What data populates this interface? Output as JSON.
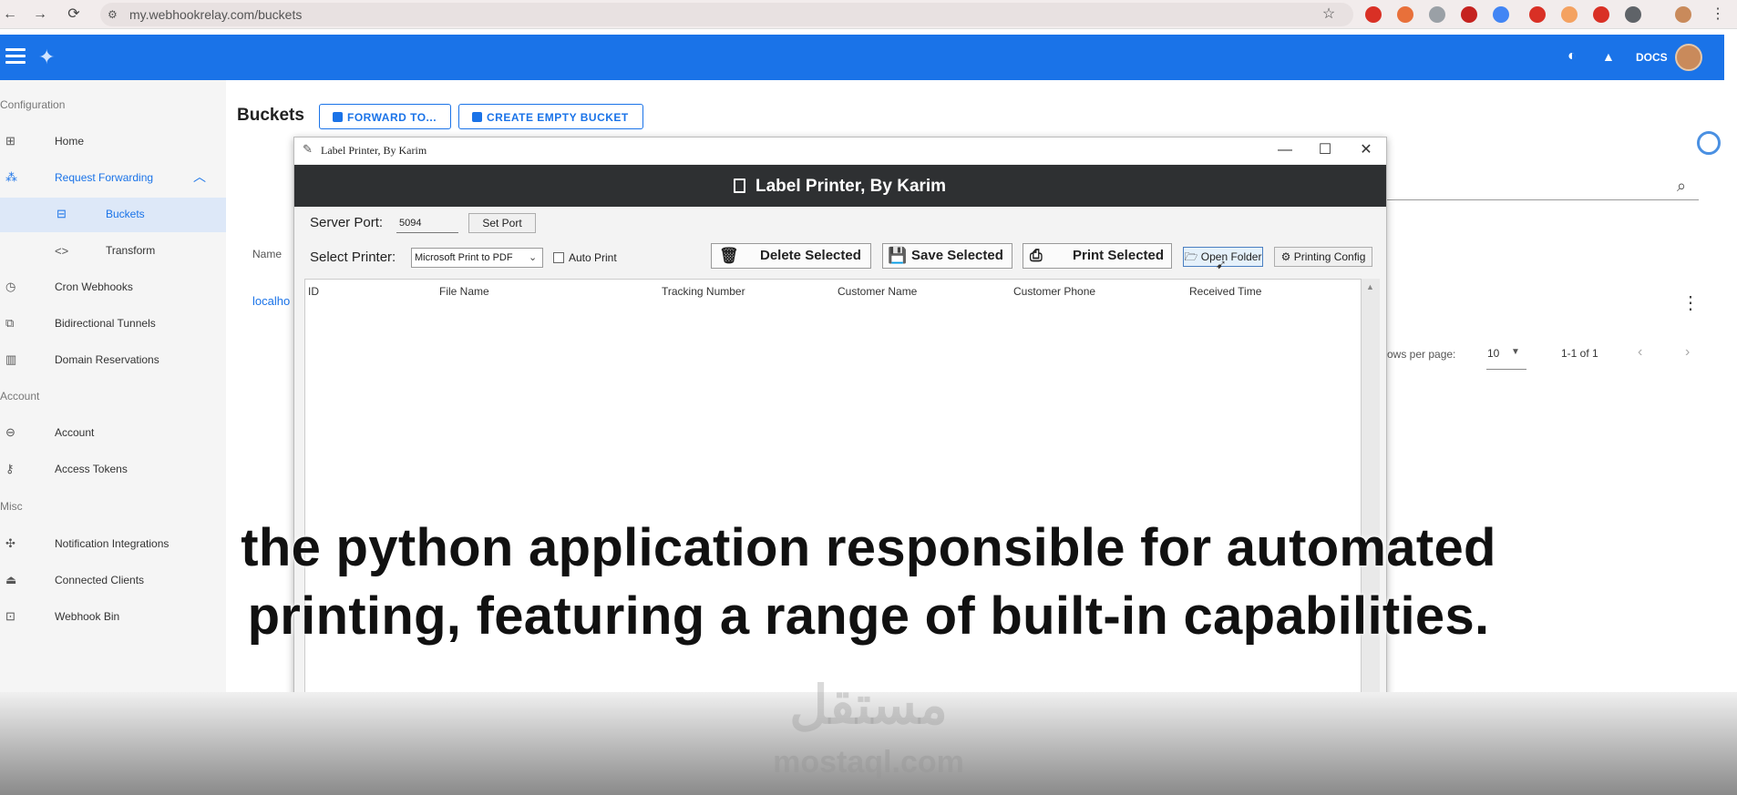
{
  "browser": {
    "url": "my.webhookrelay.com/buckets",
    "back": "←",
    "forward": "→",
    "reload": "⟳",
    "star": "☆",
    "more": "⋮"
  },
  "appbar": {
    "docs_label": "DOCS"
  },
  "sidebar": {
    "sections": {
      "configuration": "Configuration",
      "account": "Account",
      "misc": "Misc"
    },
    "items": [
      {
        "label": "Home",
        "icon": "⊞"
      },
      {
        "label": "Request Forwarding",
        "icon": "⁂"
      },
      {
        "label": "Buckets",
        "icon": "⊟"
      },
      {
        "label": "Transform",
        "icon": "<>"
      },
      {
        "label": "Cron Webhooks",
        "icon": "◷"
      },
      {
        "label": "Bidirectional Tunnels",
        "icon": "⧉"
      },
      {
        "label": "Domain Reservations",
        "icon": "▥"
      },
      {
        "label": "Account",
        "icon": "⊖"
      },
      {
        "label": "Access Tokens",
        "icon": "⚷"
      },
      {
        "label": "Notification Integrations",
        "icon": "✣"
      },
      {
        "label": "Connected Clients",
        "icon": "⏏"
      },
      {
        "label": "Webhook Bin",
        "icon": "⊡"
      }
    ]
  },
  "main": {
    "title": "Buckets",
    "forward_button": "FORWARD TO...",
    "create_button": "CREATE EMPTY BUCKET",
    "name_column": "Name",
    "row_name": "localho",
    "rows_per_page_label": "ows per page:",
    "rows_per_page_value": "10",
    "page_range": "1-1 of 1"
  },
  "dialog": {
    "window_title": "Label Printer, By Karim",
    "header_title": "Label Printer, By Karim",
    "server_port_label": "Server Port:",
    "server_port_value": "5094",
    "set_port_button": "Set Port",
    "select_printer_label": "Select Printer:",
    "printer_value": "Microsoft Print to PDF",
    "auto_print_label": "Auto Print",
    "delete_button": "Delete Selected",
    "save_button": "Save Selected",
    "print_button": "Print Selected",
    "open_folder_button": "Open Folder",
    "printing_config_button": "Printing Config",
    "columns": [
      "ID",
      "File Name",
      "Tracking Number",
      "Customer Name",
      "Customer Phone",
      "Received Time"
    ]
  },
  "caption": {
    "line1": "the python application responsible for automated",
    "line2": "printing, featuring a range of built-in capabilities."
  },
  "watermark": {
    "arabic": "مستقل",
    "latin": "mostaql.com"
  }
}
